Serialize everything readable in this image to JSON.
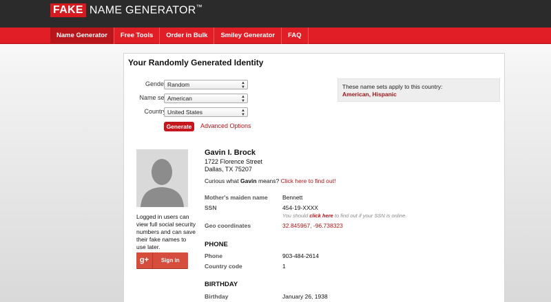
{
  "header": {
    "logo_box": "FAKE",
    "logo_text": "NAME GENERATOR",
    "logo_tm": "™"
  },
  "nav": [
    {
      "label": "Name Generator",
      "active": true
    },
    {
      "label": "Free Tools",
      "active": false
    },
    {
      "label": "Order in Bulk",
      "active": false
    },
    {
      "label": "Smiley Generator",
      "active": false
    },
    {
      "label": "FAQ",
      "active": false
    }
  ],
  "main": {
    "title": "Your Randomly Generated Identity",
    "form": {
      "gender_label": "Gender",
      "gender_value": "Random",
      "nameset_label": "Name set",
      "nameset_value": "American",
      "country_label": "Country",
      "country_value": "United States",
      "generate_label": "Generate",
      "advanced_label": "Advanced Options"
    },
    "country_box": {
      "text": "These name sets apply to this country:",
      "names": "American, Hispanic"
    }
  },
  "identity": {
    "name": "Gavin I. Brock",
    "address_line1": "1722 Florence Street",
    "address_line2": "Dallas, TX 75207",
    "curious_prefix": "Curious what",
    "curious_name": "Gavin",
    "curious_suffix": "means?",
    "curious_link": "Click here to find out!",
    "login_text": "Logged in users can view full social security numbers and can save their fake names to use later.",
    "signin_icon": "g+",
    "signin_label": "Sign in",
    "maiden_label": "Mother's maiden name",
    "maiden_value": "Bennett",
    "ssn_label": "SSN",
    "ssn_value": "454-19-XXXX",
    "ssn_note_prefix": "You should",
    "ssn_note_link": "click here",
    "ssn_note_suffix": "to find out if your SSN is online.",
    "geo_label": "Geo coordinates",
    "geo_value": "32.845967, -96.738323",
    "phone_section": "PHONE",
    "phone_label": "Phone",
    "phone_value": "903-484-2614",
    "cc_label": "Country code",
    "cc_value": "1",
    "birthday_section": "BIRTHDAY",
    "birthday_label": "Birthday",
    "birthday_value": "January 26, 1938"
  },
  "colors": {
    "brand_red": "#e11e26",
    "link_red": "#b01419",
    "header_dark": "#2b2b2b"
  }
}
